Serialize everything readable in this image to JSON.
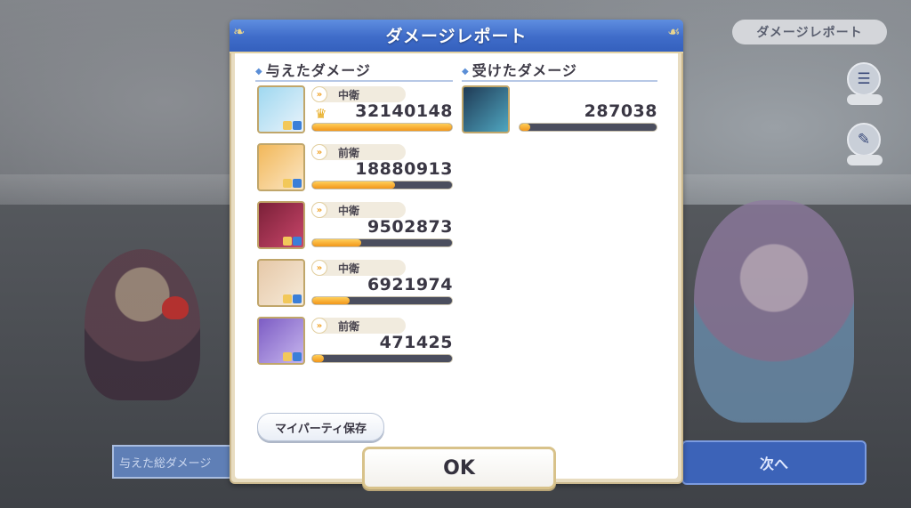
{
  "scene": {
    "top_right_button": "ダメージレポート",
    "bottom_left_label": "与えた総ダメージ",
    "next_button": "次へ"
  },
  "dialog": {
    "title": "ダメージレポート",
    "dealt": {
      "title": "与えたダメージ",
      "rows": [
        {
          "position": "中衛",
          "damage": "32140148",
          "ratio": 1.0,
          "top": true,
          "portrait_colors": [
            "#9fd8f0",
            "#e9f3fb"
          ]
        },
        {
          "position": "前衛",
          "damage": "18880913",
          "ratio": 0.59,
          "top": false,
          "portrait_colors": [
            "#f2b85a",
            "#fbe6c4"
          ]
        },
        {
          "position": "中衛",
          "damage": "9502873",
          "ratio": 0.35,
          "top": false,
          "portrait_colors": [
            "#7a2038",
            "#c9466a"
          ]
        },
        {
          "position": "中衛",
          "damage": "6921974",
          "ratio": 0.27,
          "top": false,
          "portrait_colors": [
            "#e6c8a8",
            "#f6ead8"
          ]
        },
        {
          "position": "前衛",
          "damage": "471425",
          "ratio": 0.08,
          "top": false,
          "portrait_colors": [
            "#7c5cc4",
            "#c7b6ee"
          ]
        }
      ]
    },
    "taken": {
      "title": "受けたダメージ",
      "rows": [
        {
          "damage": "287038",
          "ratio": 0.08,
          "portrait_colors": [
            "#1f3a55",
            "#4fa6c0"
          ]
        }
      ]
    },
    "save_button": "マイパーティ保存",
    "ok_button": "OK"
  },
  "colors": {
    "header_blue": "#3f6cc9",
    "bar_fill": "#f2961a",
    "frame_gold": "#cbb88e"
  }
}
